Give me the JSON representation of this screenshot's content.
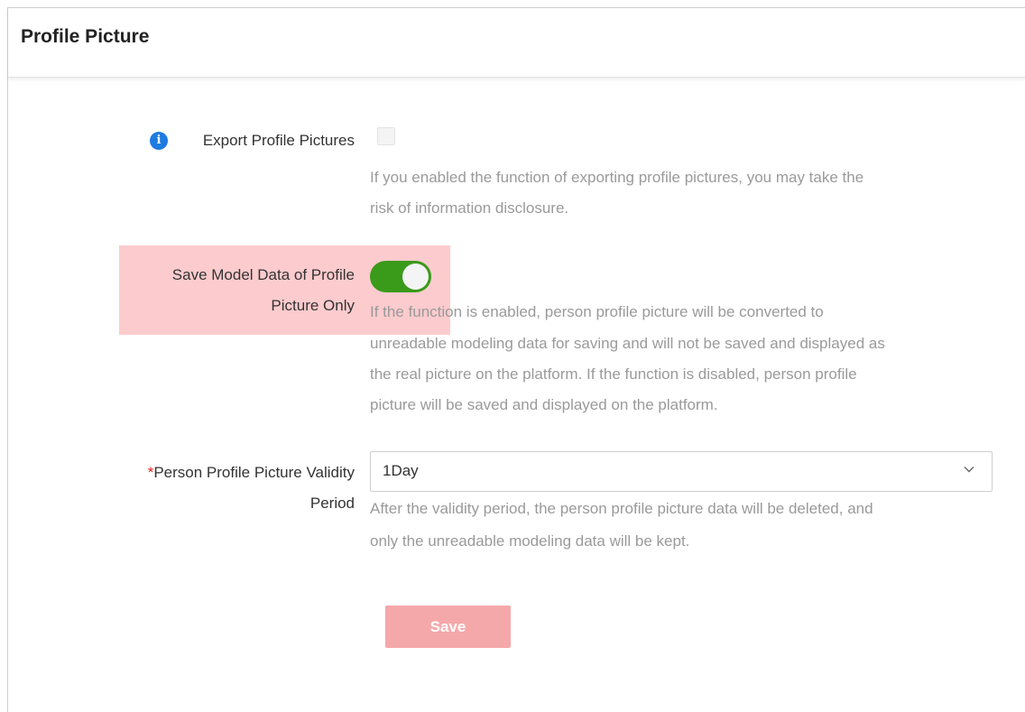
{
  "header": {
    "title": "Profile Picture"
  },
  "export_profile": {
    "label": "Export Profile Pictures",
    "info_icon": "info-icon",
    "checked": false,
    "hint_line1": "If you enabled the function of exporting profile pictures, you may take the",
    "hint_line2": "risk of information disclosure."
  },
  "save_model": {
    "label_line1": "Save Model Data of Profile",
    "label_line2": "Picture Only",
    "enabled": true,
    "hint_line1": "If the function is enabled, person profile picture will be converted to",
    "hint_line2": "unreadable modeling data for saving and will not be saved and displayed as",
    "hint_line3": "the real picture on the platform. If the function is disabled, person profile",
    "hint_line4": "picture will be saved and displayed on the platform."
  },
  "validity": {
    "required_mark": "*",
    "label_line1": "Person Profile Picture Validity",
    "label_line2": "Period",
    "selected": "1Day",
    "hint_line1": "After the validity period, the person profile picture data will be deleted, and",
    "hint_line2": "only the unreadable modeling data will be kept."
  },
  "actions": {
    "save_label": "Save"
  },
  "colors": {
    "toggle_on": "#3a9a1a",
    "info_icon": "#1e7be0",
    "highlight": "#faa0a5",
    "save_button": "#f5a8aa",
    "required": "#e02020"
  }
}
